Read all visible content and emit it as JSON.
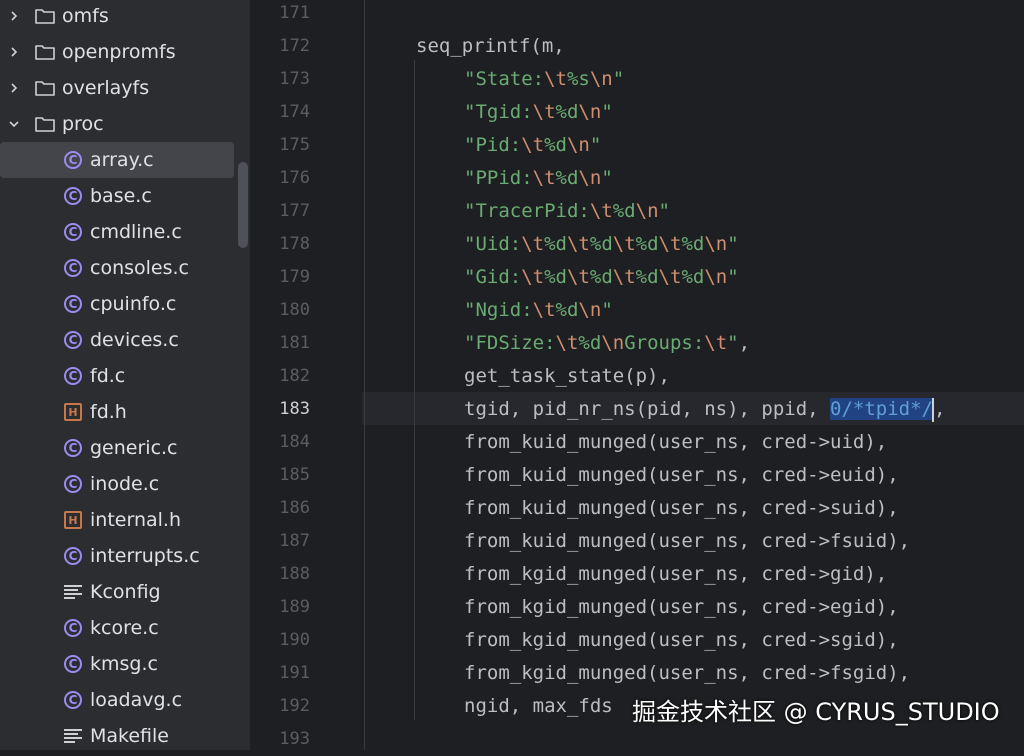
{
  "project_tree": {
    "items": [
      {
        "label": "omfs",
        "kind": "folder",
        "expanded": false
      },
      {
        "label": "openpromfs",
        "kind": "folder",
        "expanded": false
      },
      {
        "label": "overlayfs",
        "kind": "folder",
        "expanded": false
      },
      {
        "label": "proc",
        "kind": "folder",
        "expanded": true
      },
      {
        "label": "array.c",
        "kind": "c-file",
        "selected": true
      },
      {
        "label": "base.c",
        "kind": "c-file"
      },
      {
        "label": "cmdline.c",
        "kind": "c-file"
      },
      {
        "label": "consoles.c",
        "kind": "c-file"
      },
      {
        "label": "cpuinfo.c",
        "kind": "c-file"
      },
      {
        "label": "devices.c",
        "kind": "c-file"
      },
      {
        "label": "fd.c",
        "kind": "c-file"
      },
      {
        "label": "fd.h",
        "kind": "h-file"
      },
      {
        "label": "generic.c",
        "kind": "c-file"
      },
      {
        "label": "inode.c",
        "kind": "c-file"
      },
      {
        "label": "internal.h",
        "kind": "h-file"
      },
      {
        "label": "interrupts.c",
        "kind": "c-file"
      },
      {
        "label": "Kconfig",
        "kind": "text-file"
      },
      {
        "label": "kcore.c",
        "kind": "c-file"
      },
      {
        "label": "kmsg.c",
        "kind": "c-file"
      },
      {
        "label": "loadavg.c",
        "kind": "c-file"
      },
      {
        "label": "Makefile",
        "kind": "text-file"
      }
    ]
  },
  "editor": {
    "line_numbers": [
      "171",
      "172",
      "173",
      "174",
      "175",
      "176",
      "177",
      "178",
      "179",
      "180",
      "181",
      "182",
      "183",
      "184",
      "185",
      "186",
      "187",
      "188",
      "189",
      "190",
      "191",
      "192",
      "193"
    ],
    "current_line": "183",
    "lines": {
      "l172": "seq_printf(m,",
      "l173": [
        "\"State:",
        "\\t",
        "%s",
        "\\n",
        "\""
      ],
      "l174": [
        "\"Tgid:",
        "\\t",
        "%d",
        "\\n",
        "\""
      ],
      "l175": [
        "\"Pid:",
        "\\t",
        "%d",
        "\\n",
        "\""
      ],
      "l176": [
        "\"PPid:",
        "\\t",
        "%d",
        "\\n",
        "\""
      ],
      "l177": [
        "\"TracerPid:",
        "\\t",
        "%d",
        "\\n",
        "\""
      ],
      "l178": [
        "\"Uid:",
        "\\t",
        "%d",
        "\\t",
        "%d",
        "\\t",
        "%d",
        "\\t",
        "%d",
        "\\n",
        "\""
      ],
      "l179": [
        "\"Gid:",
        "\\t",
        "%d",
        "\\t",
        "%d",
        "\\t",
        "%d",
        "\\t",
        "%d",
        "\\n",
        "\""
      ],
      "l180": [
        "\"Ngid:",
        "\\t",
        "%d",
        "\\n",
        "\""
      ],
      "l181": [
        "\"FDSize:",
        "\\t",
        "%d",
        "\\n",
        "Groups:",
        "\\t",
        "\"",
        ","
      ],
      "l182": "get_task_state(p),",
      "l183_pre": "tgid, pid_nr_ns(pid, ns), ppid, ",
      "l183_sel": "0/*tpid*/",
      "l183_post": ",",
      "l184": "from_kuid_munged(user_ns, cred->uid),",
      "l185": "from_kuid_munged(user_ns, cred->euid),",
      "l186": "from_kuid_munged(user_ns, cred->suid),",
      "l187": "from_kuid_munged(user_ns, cred->fsuid),",
      "l188": "from_kgid_munged(user_ns, cred->gid),",
      "l189": "from_kgid_munged(user_ns, cred->egid),",
      "l190": "from_kgid_munged(user_ns, cred->sgid),",
      "l191": "from_kgid_munged(user_ns, cred->fsgid),",
      "l192": "ngid, max_fds"
    }
  },
  "watermark": "掘金技术社区 @ CYRUS_STUDIO",
  "colors": {
    "tree_bg": "#2b2d30",
    "editor_bg": "#1e1f22",
    "string": "#6aab73",
    "escape": "#cf8e6d",
    "selection": "#214283",
    "c_icon": "#9b8cf2",
    "h_icon": "#c7774a"
  }
}
